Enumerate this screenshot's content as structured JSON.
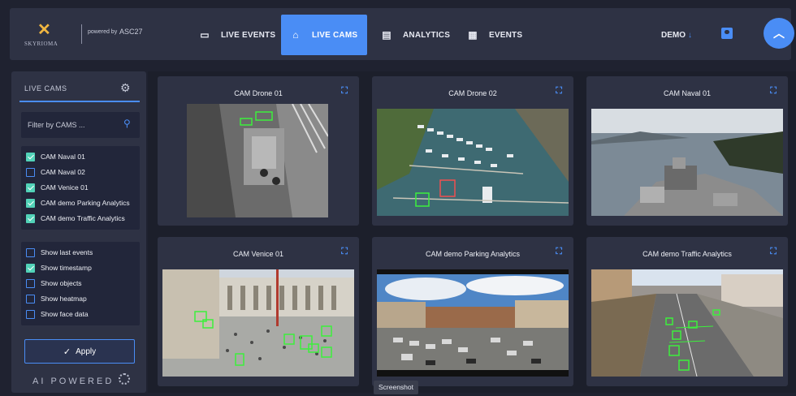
{
  "header": {
    "brand": "SKYRIOMA",
    "powered_by": "powered by",
    "partner": "ASC27",
    "nav": [
      {
        "label": "LIVE EVENTS",
        "icon": "monitor-icon",
        "active": false
      },
      {
        "label": "LIVE CAMS",
        "icon": "home-icon",
        "active": true
      },
      {
        "label": "ANALYTICS",
        "icon": "analytics-icon",
        "active": false
      },
      {
        "label": "EVENTS",
        "icon": "calendar-icon",
        "active": false
      }
    ],
    "account": "DEMO",
    "fab_icon": "chevron-up-icon"
  },
  "sidebar": {
    "title": "LIVE CAMS",
    "filter_placeholder": "Filter by CAMS ...",
    "cams": [
      {
        "label": "CAM Naval 01",
        "checked": true
      },
      {
        "label": "CAM Naval 02",
        "checked": false
      },
      {
        "label": "CAM Venice 01",
        "checked": true
      },
      {
        "label": "CAM demo Parking Analytics",
        "checked": true
      },
      {
        "label": "CAM demo Traffic Analytics",
        "checked": true
      }
    ],
    "options": [
      {
        "label": "Show last events",
        "checked": false
      },
      {
        "label": "Show timestamp",
        "checked": true
      },
      {
        "label": "Show objects",
        "checked": false
      },
      {
        "label": "Show heatmap",
        "checked": false
      },
      {
        "label": "Show face data",
        "checked": false
      }
    ],
    "apply_label": "Apply",
    "ai_label": "AI POWERED"
  },
  "cameras": [
    {
      "title": "CAM Drone 01"
    },
    {
      "title": "CAM Drone 02"
    },
    {
      "title": "CAM Naval 01"
    },
    {
      "title": "CAM Venice 01"
    },
    {
      "title": "CAM demo Parking Analytics"
    },
    {
      "title": "CAM demo Traffic Analytics"
    }
  ],
  "tooltip": "Screenshot",
  "colors": {
    "accent": "#4a8df5",
    "checked": "#52d2b8",
    "panel": "#2e3244",
    "background": "#1f2230",
    "detection": "#3cf03c"
  }
}
